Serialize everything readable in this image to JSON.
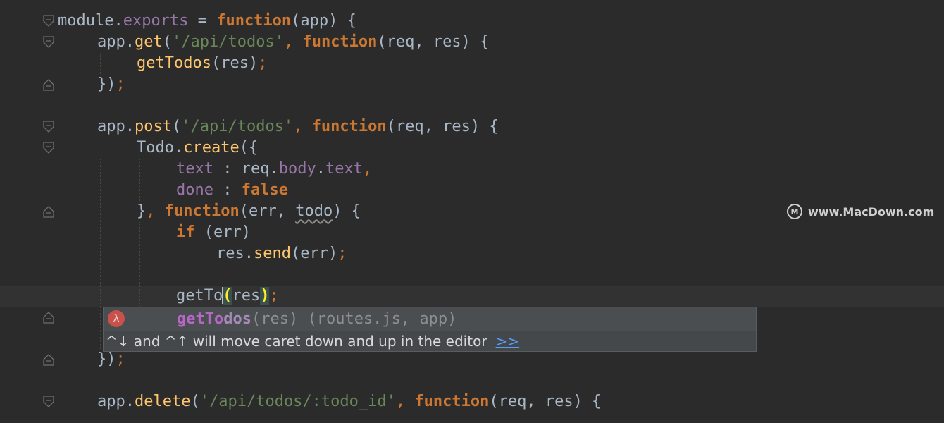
{
  "editor": {
    "colors": {
      "background": "#2b2b2b",
      "keyword": "#cc7832",
      "function": "#ffc66d",
      "string": "#6a8759",
      "property": "#9876aa",
      "plain": "#a9b7c6"
    },
    "tokens": {
      "module": "module",
      "dot": ".",
      "exports": "exports",
      "assign": " = ",
      "function": "function",
      "app": "app",
      "app_param": "(app) {",
      "get": "get",
      "post": "post",
      "delete": "delete",
      "open_paren": "(",
      "close_paren": ")",
      "api_todos": "'/api/todos'",
      "api_todos_id": "'/api/todos/:todo_id'",
      "comma": ",",
      "req_res": "(req, res) {",
      "getTodos": "getTodos",
      "res_arg": "(res)",
      "semicolon": ";",
      "close_block": "})",
      "Todo": "Todo",
      "create": "create",
      "open_obj": "({",
      "text": "text",
      "colon": " : ",
      "req": "req",
      "body": "body",
      "done": "done",
      "false": "false",
      "close_obj": "}",
      "err_params_open": "(err, ",
      "todo": "todo",
      "err_params_close": ") {",
      "if": "if",
      "err_cond": " (err)",
      "res": "res",
      "send": "send",
      "err_arg": "(err)",
      "typed": "getTo",
      "res_inner": "res"
    }
  },
  "completion": {
    "icon": "λ",
    "icon_name": "lambda-icon",
    "match": "getTo",
    "rest": "dos",
    "signature": "(res)",
    "location": " (routes.js, app)",
    "hint": "^↓ and ^↑ will move caret down and up in the editor",
    "hint_link": ">>"
  },
  "watermark": {
    "logo": "M",
    "text": "www.MacDown.com"
  }
}
